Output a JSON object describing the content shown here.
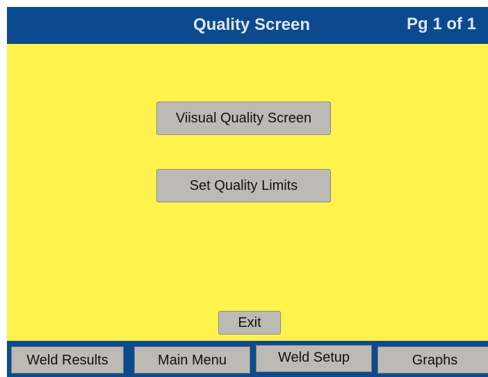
{
  "header": {
    "title": "Quality Screen",
    "page_indicator": "Pg 1 of 1"
  },
  "main": {
    "visual_quality_label": "Viisual Quality Screen",
    "set_limits_label": "Set Quality Limits",
    "exit_label": "Exit"
  },
  "footer": {
    "tabs": [
      {
        "label": "Weld Results"
      },
      {
        "label": "Main Menu"
      },
      {
        "label": "Weld Setup"
      },
      {
        "label": "Graphs"
      }
    ]
  },
  "colors": {
    "header_background": "#0b4a8f",
    "content_background": "#fef24d",
    "button_background": "#bdbab5"
  }
}
